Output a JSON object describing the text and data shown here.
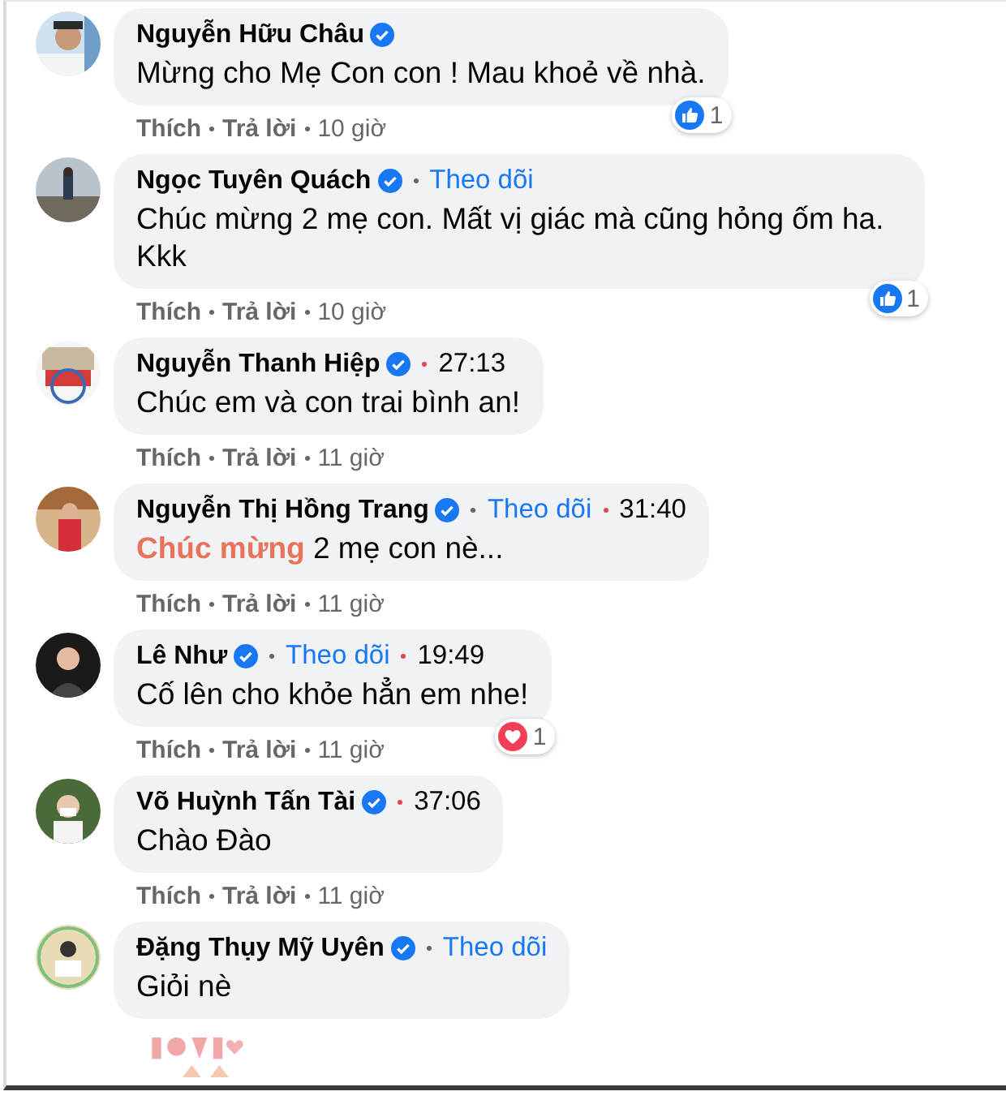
{
  "comments": [
    {
      "author": "Nguyễn Hữu Châu",
      "verified": true,
      "text": [
        {
          "kind": "plain",
          "text": "Mừng cho Mẹ Con con ! Mau khoẻ về nhà."
        }
      ],
      "actions": {
        "like": "Thích",
        "reply": "Trả lời",
        "age": "10 giờ"
      },
      "reaction": {
        "kind": "like",
        "count": "1"
      }
    },
    {
      "author": "Ngọc Tuyên Quách",
      "verified": true,
      "follow": "Theo dõi",
      "text": [
        {
          "kind": "plain",
          "text": "Chúc mừng 2 mẹ con. Mất vị giác mà cũng hỏng ốm ha. Kkk"
        }
      ],
      "actions": {
        "like": "Thích",
        "reply": "Trả lời",
        "age": "10 giờ"
      },
      "reaction": {
        "kind": "like",
        "count": "1"
      }
    },
    {
      "author": "Nguyễn Thanh Hiệp",
      "verified": true,
      "time": "27:13",
      "text": [
        {
          "kind": "plain",
          "text": "Chúc em và con trai bình an!"
        }
      ],
      "actions": {
        "like": "Thích",
        "reply": "Trả lời",
        "age": "11 giờ"
      }
    },
    {
      "author": "Nguyễn Thị Hồng Trang",
      "verified": true,
      "follow": "Theo dõi",
      "time": "31:40",
      "text": [
        {
          "kind": "highlight",
          "text": "Chúc mừng"
        },
        {
          "kind": "plain",
          "text": " 2 mẹ con nè..."
        }
      ],
      "actions": {
        "like": "Thích",
        "reply": "Trả lời",
        "age": "11 giờ"
      }
    },
    {
      "author": "Lê Như",
      "verified": true,
      "follow": "Theo dõi",
      "time": "19:49",
      "text": [
        {
          "kind": "plain",
          "text": "Cố lên cho khỏe hẳn em nhe!"
        }
      ],
      "actions": {
        "like": "Thích",
        "reply": "Trả lời",
        "age": "11 giờ"
      },
      "reaction": {
        "kind": "love",
        "count": "1"
      }
    },
    {
      "author": "Võ Huỳnh Tấn Tài",
      "verified": true,
      "time": "37:06",
      "text": [
        {
          "kind": "plain",
          "text": "Chào Đào"
        }
      ],
      "actions": {
        "like": "Thích",
        "reply": "Trả lời",
        "age": "11 giờ"
      }
    },
    {
      "author": "Đặng Thụy Mỹ Uyên",
      "verified": true,
      "follow": "Theo dõi",
      "text": [
        {
          "kind": "plain",
          "text": "Giỏi nè"
        }
      ],
      "sticker": true
    }
  ]
}
